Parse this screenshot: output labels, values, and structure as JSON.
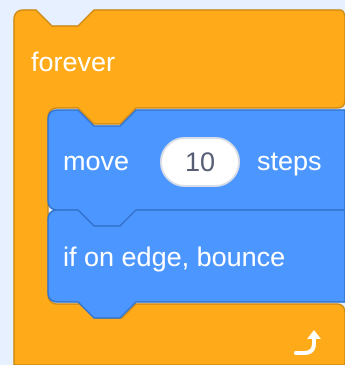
{
  "colors": {
    "control": "#ffab19",
    "control_stroke": "#cf8b17",
    "motion": "#4c97ff",
    "motion_stroke": "#3373cc",
    "input_text": "#575e75",
    "background": "#e6f0ff"
  },
  "forever_block": {
    "label": "forever",
    "loop_icon": "loop-arrow-icon"
  },
  "move_block": {
    "prefix": "move",
    "steps_value": "10",
    "suffix": "steps"
  },
  "bounce_block": {
    "label": "if on edge, bounce"
  }
}
